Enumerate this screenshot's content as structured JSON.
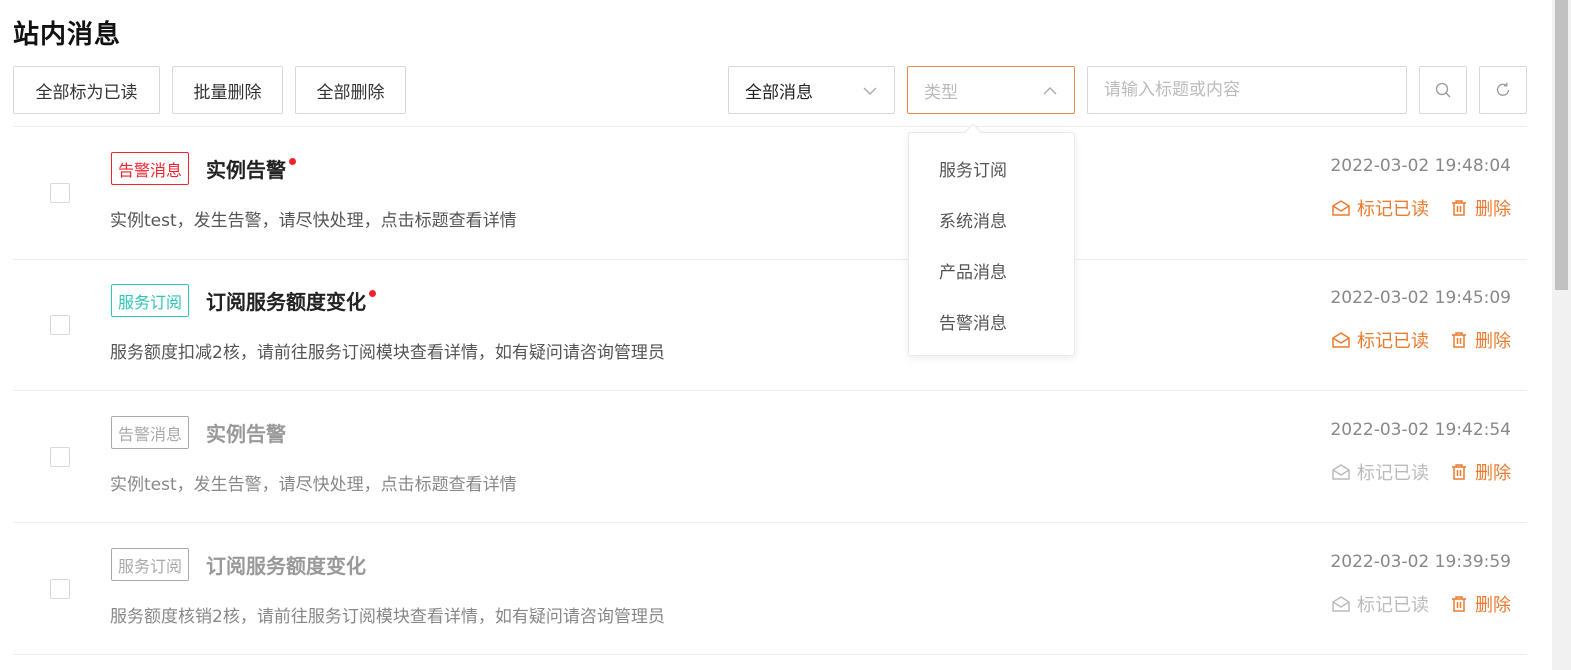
{
  "page": {
    "title": "站内消息"
  },
  "toolbar": {
    "mark_all_read": "全部标为已读",
    "batch_delete": "批量删除",
    "delete_all": "全部删除",
    "scope_select_value": "全部消息",
    "type_select_placeholder": "类型",
    "search_placeholder": "请输入标题或内容"
  },
  "type_dropdown": {
    "options": [
      "服务订阅",
      "系统消息",
      "产品消息",
      "告警消息"
    ]
  },
  "actions": {
    "mark_read": "标记已读",
    "delete": "删除"
  },
  "messages": [
    {
      "tag": "告警消息",
      "title": "实例告警",
      "desc": "实例test，发生告警，请尽快处理，点击标题查看详情",
      "time": "2022-03-02 19:48:04",
      "read": false
    },
    {
      "tag": "服务订阅",
      "title": "订阅服务额度变化",
      "desc": "服务额度扣减2核，请前往服务订阅模块查看详情，如有疑问请咨询管理员",
      "time": "2022-03-02 19:45:09",
      "read": false
    },
    {
      "tag": "告警消息",
      "title": "实例告警",
      "desc": "实例test，发生告警，请尽快处理，点击标题查看详情",
      "time": "2022-03-02 19:42:54",
      "read": true
    },
    {
      "tag": "服务订阅",
      "title": "订阅服务额度变化",
      "desc": "服务额度核销2核，请前往服务订阅模块查看详情，如有疑问请咨询管理员",
      "time": "2022-03-02 19:39:59",
      "read": true
    }
  ],
  "colors": {
    "accent": "#ec7a2e",
    "alarm_tag": "#f5222d",
    "subscription_tag": "#2ec7b5",
    "unread_dot": "#f5222d",
    "read_gray": "#bbbbbb"
  },
  "icons": {
    "mark_read": "envelope-open-icon",
    "delete": "trash-icon",
    "search": "search-icon",
    "refresh": "refresh-icon",
    "chevron_down": "chevron-down-icon",
    "chevron_up": "chevron-up-icon"
  }
}
